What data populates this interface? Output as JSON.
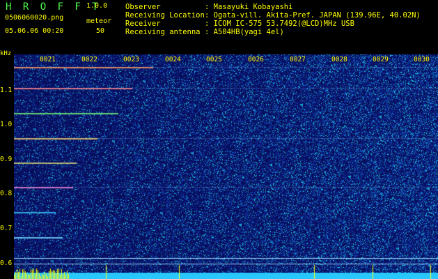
{
  "app": {
    "title": "H R O F F T",
    "version": "1.0.0",
    "filename": "0506060020.png",
    "datetime": "05.06.06 00:20",
    "meteor_label": "meteor",
    "meteor_count": "50"
  },
  "header": [
    {
      "label": "Observer",
      "value": ": Masayuki Kobayashi"
    },
    {
      "label": "Receiving Location",
      "value": ": Ogata-vill. Akita-Pref. JAPAN (139.96E, 40.02N)"
    },
    {
      "label": "Receiver",
      "value": ": ICOM IC-575 53.7492(@LCD)MHz USB"
    },
    {
      "label": "Receiving antenna",
      "value": ": A504HB(yagi 4el)"
    }
  ],
  "axis": {
    "y_unit": "kHz",
    "y_ticks": [
      "1.1",
      "1.0",
      "0.9",
      "0.8",
      "0.7",
      "0.6"
    ],
    "x_ticks": [
      "0021",
      "0022",
      "0023",
      "0024",
      "0025",
      "0026",
      "0027",
      "0028",
      "0029",
      "0030"
    ]
  },
  "colors": {
    "green": "#4cff4c",
    "yellow": "#ffff00",
    "background": "#000000",
    "noise_base": "#0a1566"
  }
}
